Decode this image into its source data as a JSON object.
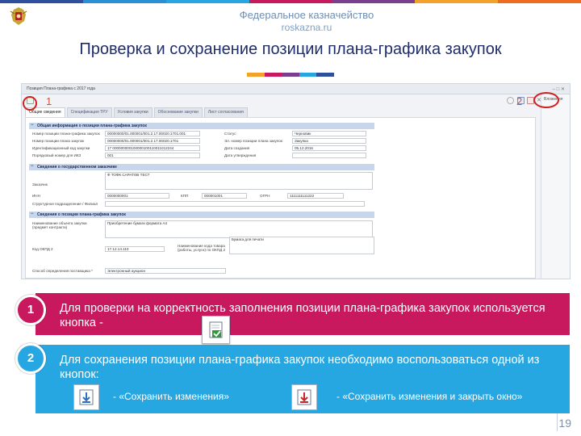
{
  "header": {
    "agency_name": "Федеральное казначейство",
    "agency_site": "roskazna.ru"
  },
  "page_title": "Проверка и сохранение позиции плана-графика закупок",
  "colors": {
    "strip": [
      "#2e4f9e",
      "#2b8fd3",
      "#27a7e2",
      "#c8195e",
      "#7a3e8f",
      "#f2a12a",
      "#f06b22"
    ],
    "title_bar": [
      "#f2a12a",
      "#c8195e",
      "#7a3e8f",
      "#27a7e2",
      "#2e4f9e"
    ],
    "band_pink": "#c8195e",
    "band_blue": "#27a7e2",
    "marker_red": "#d3201f"
  },
  "screenshot": {
    "window_title": "Позиция Плана-графика с 2017 года",
    "side_panel_label": "Вложения",
    "markers": {
      "first": "1",
      "second": "2"
    },
    "tabs": [
      "Общие сведения",
      "Спецификация ТРУ",
      "Условия закупки",
      "Обоснование закупки",
      "Лист согласования"
    ],
    "sections": {
      "general": "Общая информация о позиции плана-графика закупок",
      "customer": "Сведения о государственном заказчике",
      "position": "Сведения о позиции плана-графика закупок"
    },
    "general_fields": [
      {
        "label": "Номер позиции плана-графика закупок",
        "value": "00000000/01.000001/001.2.17.00020.1701.001"
      },
      {
        "label": "Номер позиции плана закупок",
        "value": "00000000/01.000001/001.2.17.00020.1701"
      },
      {
        "label": "Идентификационный код закупки",
        "value": "17 000000000100000100110011012244"
      },
      {
        "label": "Порядковый номер для ИКЗ",
        "value": "001"
      }
    ],
    "general_right_fields": [
      {
        "label": "Статус",
        "value": "Черновик"
      },
      {
        "label": "Эл. номер позиции плана закупок",
        "value": "Закупка"
      },
      {
        "label": "Дата создания",
        "value": "05.12.2016"
      },
      {
        "label": "Дата утверждения",
        "value": ""
      }
    ],
    "customer_fields": {
      "customer_label": "Заказчик",
      "customer_value": "Ф ТОФК САРАТОВ ТЕСТ",
      "inn_label": "ИНН",
      "inn_value": "0000000001",
      "kpp_label": "КПП",
      "kpp_value": "000001001",
      "ogrn_label": "ОГРН",
      "ogrn_value": "1111111111222",
      "unit_label": "Структурное подразделение / Филиал"
    },
    "position_fields": {
      "object_label": "Наименование объекта закупки (предмет контракта)",
      "object_value": "Приобретение бумаги формата А4",
      "okpd_label": "Код ОКПД 2",
      "okpd_value": "17.12.14.110",
      "okpd_name_label": "Наименование кода товара (работы, услуги) по ОКПД 2",
      "okpd_name_value": "Бумага для печати",
      "method_label": "Способ определения поставщика *",
      "method_value": "Электронный аукцион"
    }
  },
  "step1": {
    "number": "1",
    "text": "Для проверки на корректность заполнения позиции плана-графика закупок используется кнопка  -"
  },
  "step2": {
    "number": "2",
    "text": "Для сохранения позиции плана-графика закупок необходимо воспользоваться одной из кнопок:",
    "save_label": "- «Сохранить изменения»",
    "save_close_label": "- «Сохранить изменения и закрыть окно»"
  },
  "slide_number": "19"
}
